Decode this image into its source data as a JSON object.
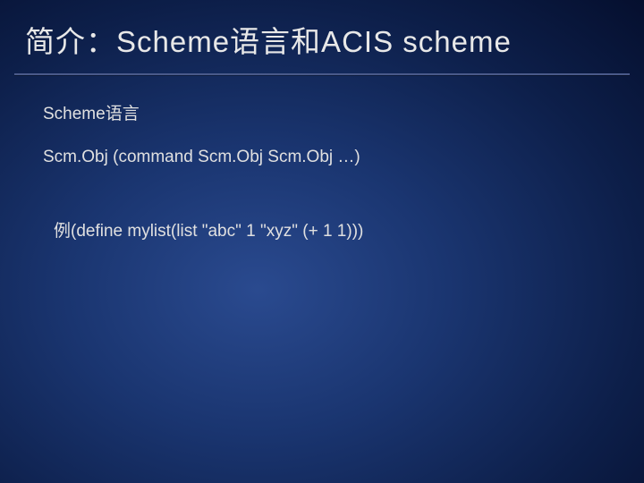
{
  "slide": {
    "title": "简介：Scheme语言和ACIS scheme",
    "subtitle": "Scheme语言",
    "syntax_line": "Scm.Obj (command Scm.Obj Scm.Obj …)",
    "example_line": "例(define mylist(list \"abc\" 1 \"xyz\" (+ 1 1)))"
  }
}
